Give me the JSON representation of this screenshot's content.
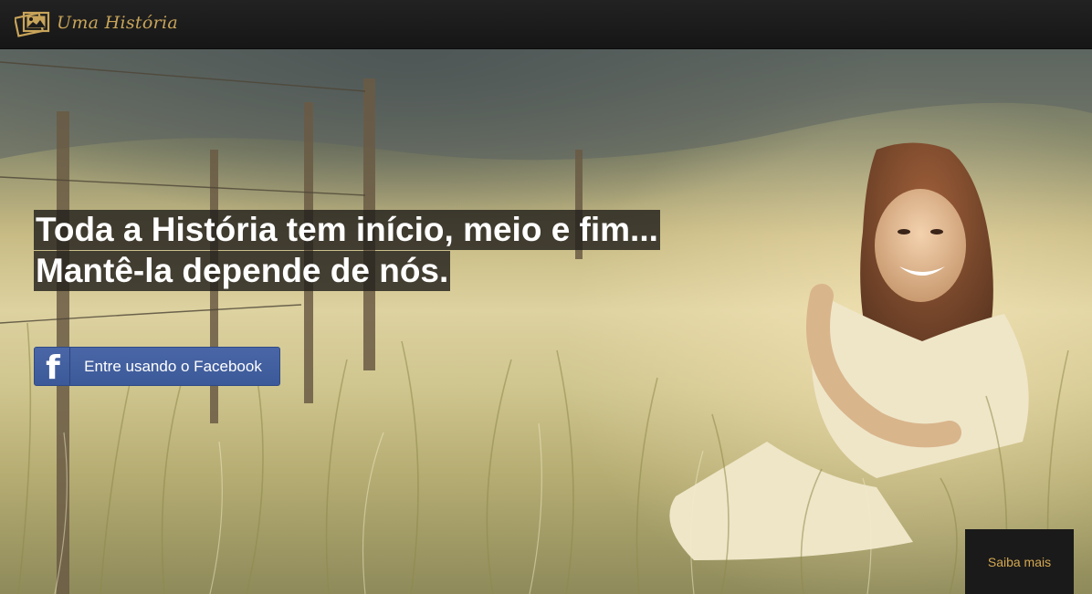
{
  "header": {
    "brand": "Uma História",
    "logo_icon": "photo-frames-icon"
  },
  "hero": {
    "headline_line1": "Toda a História tem início, meio e fim...",
    "headline_line2": "Mantê-la depende de nós.",
    "facebook_button_label": "Entre usando o Facebook",
    "facebook_icon": "facebook-f-icon"
  },
  "footer": {
    "saiba_mais": "Saiba mais"
  },
  "colors": {
    "brand_gold": "#c8a45a",
    "facebook_blue": "#3b5998",
    "topbar": "#1b1b1b"
  }
}
